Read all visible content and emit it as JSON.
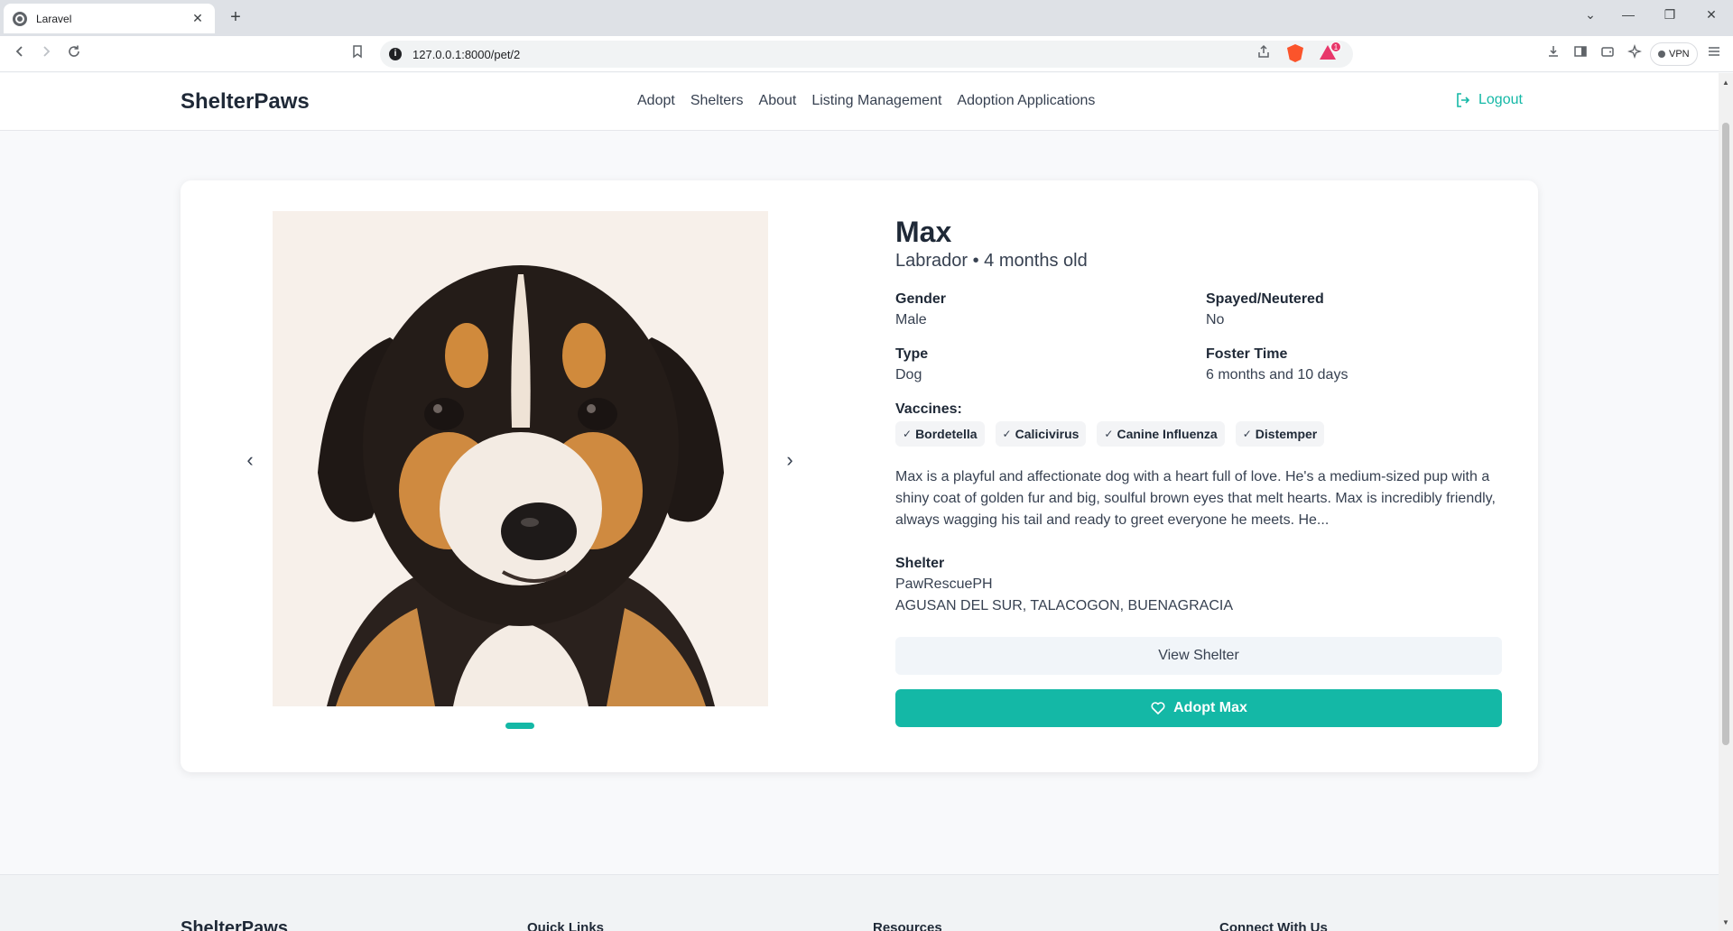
{
  "browser": {
    "tab_title": "Laravel",
    "tab_close": "✕",
    "new_tab": "+",
    "url": "127.0.0.1:8000/pet/2",
    "info": "i",
    "rewards_count": "1",
    "vpn_label": "VPN",
    "window_controls": [
      "⌄",
      "—",
      "❐",
      "✕"
    ]
  },
  "site": {
    "brand": "ShelterPaws",
    "nav": [
      "Adopt",
      "Shelters",
      "About",
      "Listing Management",
      "Adoption Applications"
    ],
    "logout": "Logout"
  },
  "pet": {
    "name": "Max",
    "subtitle": "Labrador • 4 months old",
    "facts": [
      {
        "label": "Gender",
        "value": "Male"
      },
      {
        "label": "Spayed/Neutered",
        "value": "No"
      },
      {
        "label": "Type",
        "value": "Dog"
      },
      {
        "label": "Foster Time",
        "value": "6 months and 10 days"
      }
    ],
    "vaccines_label": "Vaccines:",
    "vaccines": [
      "Bordetella",
      "Calicivirus",
      "Canine Influenza",
      "Distemper"
    ],
    "description": "Max is a playful and affectionate dog with a heart full of love. He's a medium-sized pup with a shiny coat of golden fur and big, soulful brown eyes that melt hearts. Max is incredibly friendly, always wagging his tail and ready to greet everyone he meets. He...",
    "shelter_label": "Shelter",
    "shelter_name": "PawRescuePH",
    "shelter_address": "AGUSAN DEL SUR, TALACOGON, BUENAGRACIA",
    "view_shelter": "View Shelter",
    "adopt": "Adopt Max",
    "carousel_prev": "‹",
    "carousel_next": "›",
    "photo_count": 1,
    "photo_index": 1
  },
  "footer": {
    "brand": "ShelterPaws",
    "headings": [
      "Quick Links",
      "Resources",
      "Connect With Us"
    ]
  },
  "colors": {
    "accent": "#14b8a6"
  }
}
